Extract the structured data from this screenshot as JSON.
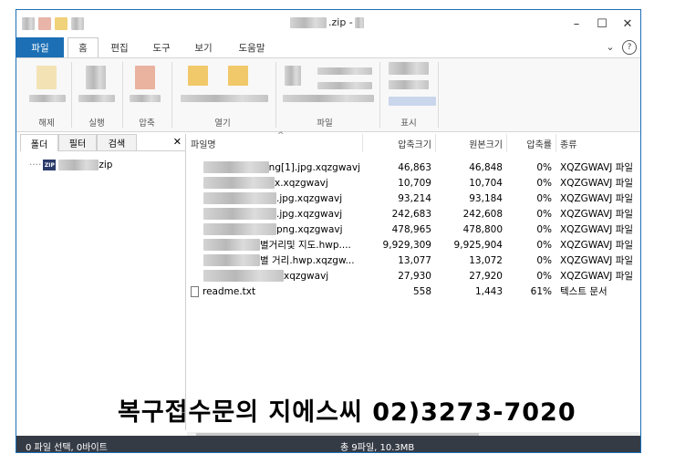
{
  "window": {
    "title_suffix": ".zip - ",
    "controls": {
      "minimize": "–",
      "maximize": "☐",
      "close": "✕"
    }
  },
  "ribbon_tabs": [
    "파일",
    "홈",
    "편집",
    "도구",
    "보기",
    "도움말"
  ],
  "help": {
    "collapse": "⌄",
    "help": "?"
  },
  "ribbon_groups": [
    "해제",
    "실행",
    "압축",
    "열기",
    "파일",
    "표시"
  ],
  "left_pane": {
    "tabs": [
      "폴더",
      "필터",
      "검색"
    ],
    "close": "✕",
    "tree": {
      "badge": "ZIP",
      "suffix": "zip"
    }
  },
  "file_list": {
    "sort_indicator": "^",
    "columns": [
      "파일명",
      "압축크기",
      "원본크기",
      "압축률",
      "종류"
    ],
    "rows": [
      {
        "name": "ng[1].jpg.xqzgwavj",
        "packed": "46,863",
        "original": "46,848",
        "ratio": "0%",
        "type": "XQZGWAVJ 파일"
      },
      {
        "name": "x.xqzgwavj",
        "packed": "10,709",
        "original": "10,704",
        "ratio": "0%",
        "type": "XQZGWAVJ 파일"
      },
      {
        "name": ".jpg.xqzgwavj",
        "packed": "93,214",
        "original": "93,184",
        "ratio": "0%",
        "type": "XQZGWAVJ 파일"
      },
      {
        "name": ".jpg.xqzgwavj",
        "packed": "242,683",
        "original": "242,608",
        "ratio": "0%",
        "type": "XQZGWAVJ 파일"
      },
      {
        "name": "png.xqzgwavj",
        "packed": "478,965",
        "original": "478,800",
        "ratio": "0%",
        "type": "XQZGWAVJ 파일"
      },
      {
        "name": "별거리및 지도.hwp....",
        "packed": "9,929,309",
        "original": "9,925,904",
        "ratio": "0%",
        "type": "XQZGWAVJ 파일"
      },
      {
        "name": "별 거리.hwp.xqzgw...",
        "packed": "13,077",
        "original": "13,072",
        "ratio": "0%",
        "type": "XQZGWAVJ 파일"
      },
      {
        "name": "xqzgwavj",
        "packed": "27,930",
        "original": "27,920",
        "ratio": "0%",
        "type": "XQZGWAVJ 파일"
      },
      {
        "name": "readme.txt",
        "packed": "558",
        "original": "1,443",
        "ratio": "61%",
        "type": "텍스트 문서"
      }
    ]
  },
  "status": {
    "left": "0 파일 선택, 0바이트",
    "center": "총 9파일, 10.3MB"
  },
  "overlay_text": "복구접수문의 지에스씨 02)3273-7020"
}
